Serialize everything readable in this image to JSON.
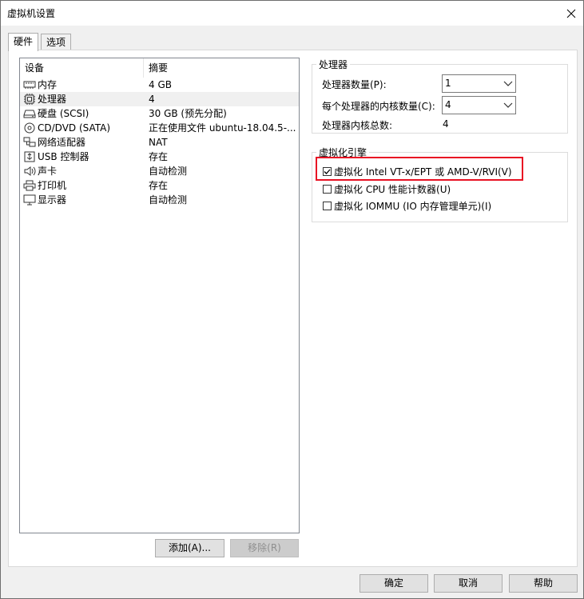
{
  "window": {
    "title": "虚拟机设置",
    "close_icon": "close-icon"
  },
  "tabs": [
    {
      "label": "硬件",
      "active": true
    },
    {
      "label": "选项",
      "active": false
    }
  ],
  "device_list": {
    "headers": {
      "device": "设备",
      "summary": "摘要"
    },
    "rows": [
      {
        "icon": "memory-icon",
        "device": "内存",
        "summary": "4 GB",
        "selected": false
      },
      {
        "icon": "processor-icon",
        "device": "处理器",
        "summary": "4",
        "selected": true
      },
      {
        "icon": "hard-disk-icon",
        "device": "硬盘 (SCSI)",
        "summary": "30 GB (预先分配)",
        "selected": false
      },
      {
        "icon": "cd-dvd-icon",
        "device": "CD/DVD (SATA)",
        "summary": "正在使用文件 ubuntu-18.04.5-...",
        "selected": false
      },
      {
        "icon": "network-adapter-icon",
        "device": "网络适配器",
        "summary": "NAT",
        "selected": false
      },
      {
        "icon": "usb-icon",
        "device": "USB 控制器",
        "summary": "存在",
        "selected": false
      },
      {
        "icon": "sound-card-icon",
        "device": "声卡",
        "summary": "自动检测",
        "selected": false
      },
      {
        "icon": "printer-icon",
        "device": "打印机",
        "summary": "存在",
        "selected": false
      },
      {
        "icon": "display-icon",
        "device": "显示器",
        "summary": "自动检测",
        "selected": false
      }
    ]
  },
  "list_buttons": {
    "add": "添加(A)...",
    "remove": "移除(R)"
  },
  "processor_group": {
    "title": "处理器",
    "count_label": "处理器数量(P):",
    "count_value": "1",
    "cores_label": "每个处理器的内核数量(C):",
    "cores_value": "4",
    "total_label": "处理器内核总数:",
    "total_value": "4"
  },
  "virtualization_group": {
    "title": "虚拟化引擎",
    "options": [
      {
        "label": "虚拟化 Intel VT-x/EPT 或 AMD-V/RVI(V)",
        "checked": true
      },
      {
        "label": "虚拟化 CPU 性能计数器(U)",
        "checked": false
      },
      {
        "label": "虚拟化 IOMMU (IO 内存管理单元)(I)",
        "checked": false
      }
    ]
  },
  "footer": {
    "ok": "确定",
    "cancel": "取消",
    "help": "帮助"
  },
  "colors": {
    "highlight": "#e81123",
    "selected_row": "#f0f0f0"
  }
}
